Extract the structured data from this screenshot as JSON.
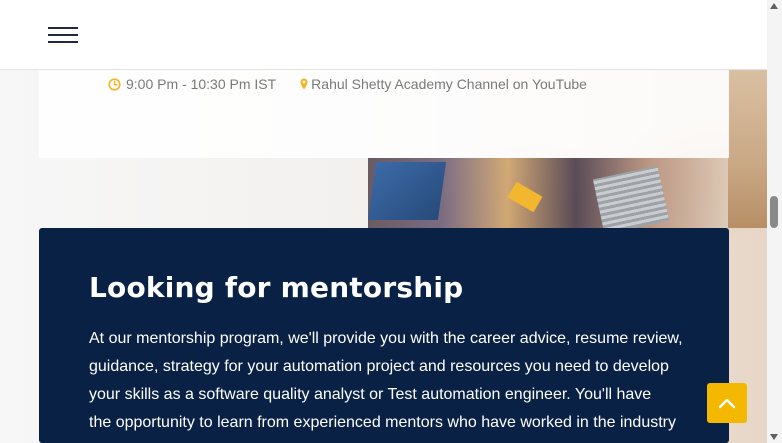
{
  "header": {
    "menu_icon": "hamburger-menu-icon"
  },
  "event": {
    "time_icon": "clock-icon",
    "time": "9:00 Pm - 10:30 Pm IST",
    "location_icon": "map-marker-icon",
    "location": "Rahul Shetty Academy Channel on YouTube"
  },
  "mentorship": {
    "title": "Looking for mentorship",
    "lines": [
      "At our mentorship program, we'll provide you with the career advice, resume review,",
      "guidance, strategy for your automation project and resources you need to develop",
      "your skills as a software quality analyst or Test automation engineer. You'll have",
      "the opportunity to learn from experienced mentors who have worked in the industry"
    ]
  },
  "scroll_top": {
    "icon": "chevron-up-icon"
  },
  "colors": {
    "accent": "#f5b800",
    "navy": "#0a2146",
    "meta_text": "#7a7a7a"
  }
}
